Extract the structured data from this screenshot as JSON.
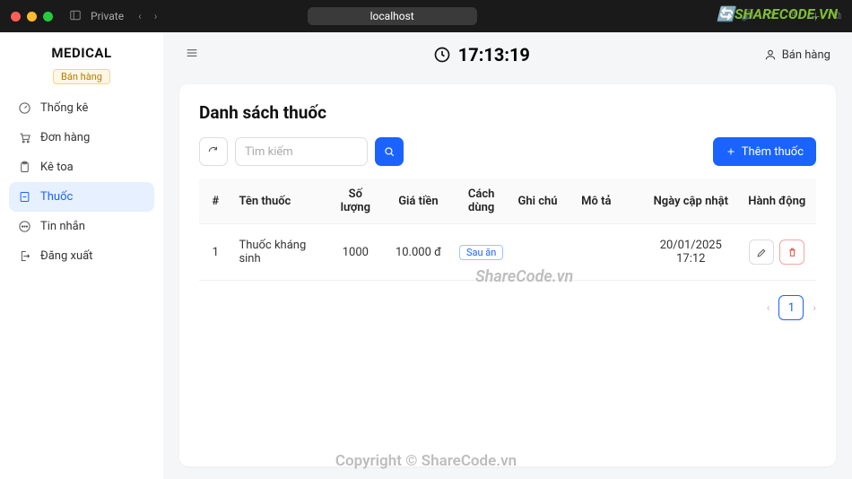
{
  "chrome": {
    "private_label": "Private",
    "url": "localhost"
  },
  "sidebar": {
    "brand": "MEDICAL",
    "sales_tag": "Bán hàng",
    "items": [
      {
        "label": "Thống kê"
      },
      {
        "label": "Đơn hàng"
      },
      {
        "label": "Kê toa"
      },
      {
        "label": "Thuốc"
      },
      {
        "label": "Tin nhắn"
      },
      {
        "label": "Đăng xuất"
      }
    ]
  },
  "header": {
    "clock": "17:13:19",
    "right_label": "Bán hàng"
  },
  "page": {
    "title": "Danh sách thuốc",
    "search_placeholder": "Tìm kiếm",
    "add_button": "Thêm thuốc"
  },
  "table": {
    "columns": {
      "index": "#",
      "name": "Tên thuốc",
      "qty": "Số lượng",
      "price": "Giá tiền",
      "usage": "Cách dùng",
      "note": "Ghi chú",
      "desc": "Mô tả",
      "updated": "Ngày cập nhật",
      "actions": "Hành động"
    },
    "rows": [
      {
        "index": "1",
        "name": "Thuốc kháng sinh",
        "qty": "1000",
        "price": "10.000 đ",
        "usage": "Sau ăn",
        "note": "",
        "desc": "",
        "updated": "20/01/2025 17:12"
      }
    ]
  },
  "pagination": {
    "current": "1"
  },
  "watermark": {
    "logo": "SHARECODE.VN",
    "center": "ShareCode.vn",
    "footer": "Copyright © ShareCode.vn"
  }
}
